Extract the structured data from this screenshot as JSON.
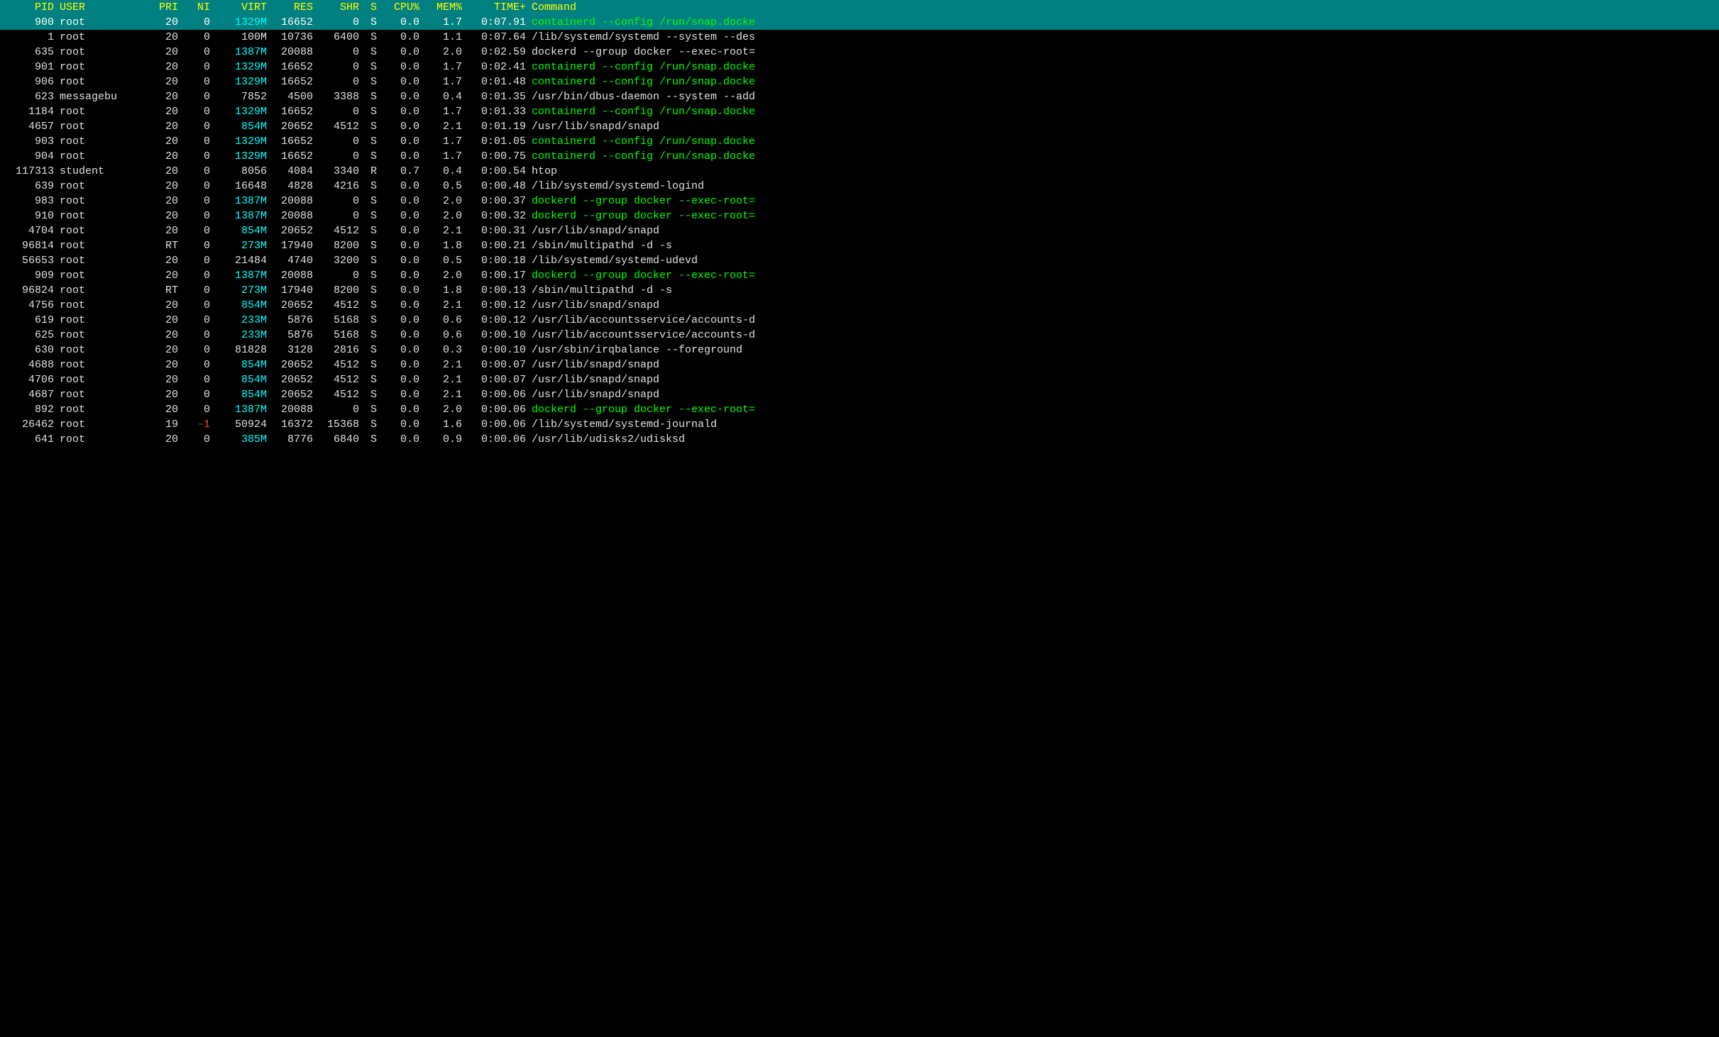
{
  "header": {
    "columns": [
      "PID",
      "USER",
      "PRI",
      "NI",
      "VIRT",
      "RES",
      "SHR",
      "S",
      "CPU%",
      "MEM%",
      "TIME+",
      "Command"
    ]
  },
  "processes": [
    {
      "pid": "900",
      "user": "root",
      "pri": "20",
      "ni": "0",
      "virt": "1329M",
      "res": "16652",
      "shr": "0",
      "s": "S",
      "cpu": "0.0",
      "mem": "1.7",
      "time": "0:07.91",
      "cmd": "containerd --config /run/snap.docke",
      "selected": true,
      "cmd_color": "green"
    },
    {
      "pid": "1",
      "user": "root",
      "pri": "20",
      "ni": "0",
      "virt": "100M",
      "res": "10736",
      "shr": "6400",
      "s": "S",
      "cpu": "0.0",
      "mem": "1.1",
      "time": "0:07.64",
      "cmd": "/lib/systemd/systemd --system --des",
      "selected": false,
      "cmd_color": "white"
    },
    {
      "pid": "635",
      "user": "root",
      "pri": "20",
      "ni": "0",
      "virt": "1387M",
      "res": "20088",
      "shr": "0",
      "s": "S",
      "cpu": "0.0",
      "mem": "2.0",
      "time": "0:02.59",
      "cmd": "dockerd --group docker --exec-root=",
      "selected": false,
      "cmd_color": "white"
    },
    {
      "pid": "901",
      "user": "root",
      "pri": "20",
      "ni": "0",
      "virt": "1329M",
      "res": "16652",
      "shr": "0",
      "s": "S",
      "cpu": "0.0",
      "mem": "1.7",
      "time": "0:02.41",
      "cmd": "containerd --config /run/snap.docke",
      "selected": false,
      "cmd_color": "green"
    },
    {
      "pid": "906",
      "user": "root",
      "pri": "20",
      "ni": "0",
      "virt": "1329M",
      "res": "16652",
      "shr": "0",
      "s": "S",
      "cpu": "0.0",
      "mem": "1.7",
      "time": "0:01.48",
      "cmd": "containerd --config /run/snap.docke",
      "selected": false,
      "cmd_color": "green"
    },
    {
      "pid": "623",
      "user": "messagebu",
      "pri": "20",
      "ni": "0",
      "virt": "7852",
      "res": "4500",
      "shr": "3388",
      "s": "S",
      "cpu": "0.0",
      "mem": "0.4",
      "time": "0:01.35",
      "cmd": "/usr/bin/dbus-daemon --system --add",
      "selected": false,
      "cmd_color": "white"
    },
    {
      "pid": "1184",
      "user": "root",
      "pri": "20",
      "ni": "0",
      "virt": "1329M",
      "res": "16652",
      "shr": "0",
      "s": "S",
      "cpu": "0.0",
      "mem": "1.7",
      "time": "0:01.33",
      "cmd": "containerd --config /run/snap.docke",
      "selected": false,
      "cmd_color": "green"
    },
    {
      "pid": "4657",
      "user": "root",
      "pri": "20",
      "ni": "0",
      "virt": "854M",
      "res": "20652",
      "shr": "4512",
      "s": "S",
      "cpu": "0.0",
      "mem": "2.1",
      "time": "0:01.19",
      "cmd": "/usr/lib/snapd/snapd",
      "selected": false,
      "cmd_color": "white"
    },
    {
      "pid": "903",
      "user": "root",
      "pri": "20",
      "ni": "0",
      "virt": "1329M",
      "res": "16652",
      "shr": "0",
      "s": "S",
      "cpu": "0.0",
      "mem": "1.7",
      "time": "0:01.05",
      "cmd": "containerd --config /run/snap.docke",
      "selected": false,
      "cmd_color": "green"
    },
    {
      "pid": "904",
      "user": "root",
      "pri": "20",
      "ni": "0",
      "virt": "1329M",
      "res": "16652",
      "shr": "0",
      "s": "S",
      "cpu": "0.0",
      "mem": "1.7",
      "time": "0:00.75",
      "cmd": "containerd --config /run/snap.docke",
      "selected": false,
      "cmd_color": "green"
    },
    {
      "pid": "117313",
      "user": "student",
      "pri": "20",
      "ni": "0",
      "virt": "8056",
      "res": "4084",
      "shr": "3340",
      "s": "R",
      "cpu": "0.7",
      "mem": "0.4",
      "time": "0:00.54",
      "cmd": "htop",
      "selected": false,
      "cmd_color": "white"
    },
    {
      "pid": "639",
      "user": "root",
      "pri": "20",
      "ni": "0",
      "virt": "16648",
      "res": "4828",
      "shr": "4216",
      "s": "S",
      "cpu": "0.0",
      "mem": "0.5",
      "time": "0:00.48",
      "cmd": "/lib/systemd/systemd-logind",
      "selected": false,
      "cmd_color": "white"
    },
    {
      "pid": "983",
      "user": "root",
      "pri": "20",
      "ni": "0",
      "virt": "1387M",
      "res": "20088",
      "shr": "0",
      "s": "S",
      "cpu": "0.0",
      "mem": "2.0",
      "time": "0:00.37",
      "cmd": "dockerd --group docker --exec-root=",
      "selected": false,
      "cmd_color": "green"
    },
    {
      "pid": "910",
      "user": "root",
      "pri": "20",
      "ni": "0",
      "virt": "1387M",
      "res": "20088",
      "shr": "0",
      "s": "S",
      "cpu": "0.0",
      "mem": "2.0",
      "time": "0:00.32",
      "cmd": "dockerd --group docker --exec-root=",
      "selected": false,
      "cmd_color": "green"
    },
    {
      "pid": "4704",
      "user": "root",
      "pri": "20",
      "ni": "0",
      "virt": "854M",
      "res": "20652",
      "shr": "4512",
      "s": "S",
      "cpu": "0.0",
      "mem": "2.1",
      "time": "0:00.31",
      "cmd": "/usr/lib/snapd/snapd",
      "selected": false,
      "cmd_color": "white"
    },
    {
      "pid": "96814",
      "user": "root",
      "pri": "RT",
      "ni": "0",
      "virt": "273M",
      "res": "17940",
      "shr": "8200",
      "s": "S",
      "cpu": "0.0",
      "mem": "1.8",
      "time": "0:00.21",
      "cmd": "/sbin/multipathd -d -s",
      "selected": false,
      "cmd_color": "white"
    },
    {
      "pid": "56653",
      "user": "root",
      "pri": "20",
      "ni": "0",
      "virt": "21484",
      "res": "4740",
      "shr": "3200",
      "s": "S",
      "cpu": "0.0",
      "mem": "0.5",
      "time": "0:00.18",
      "cmd": "/lib/systemd/systemd-udevd",
      "selected": false,
      "cmd_color": "white"
    },
    {
      "pid": "909",
      "user": "root",
      "pri": "20",
      "ni": "0",
      "virt": "1387M",
      "res": "20088",
      "shr": "0",
      "s": "S",
      "cpu": "0.0",
      "mem": "2.0",
      "time": "0:00.17",
      "cmd": "dockerd --group docker --exec-root=",
      "selected": false,
      "cmd_color": "green"
    },
    {
      "pid": "96824",
      "user": "root",
      "pri": "RT",
      "ni": "0",
      "virt": "273M",
      "res": "17940",
      "shr": "8200",
      "s": "S",
      "cpu": "0.0",
      "mem": "1.8",
      "time": "0:00.13",
      "cmd": "/sbin/multipathd -d -s",
      "selected": false,
      "cmd_color": "white"
    },
    {
      "pid": "4756",
      "user": "root",
      "pri": "20",
      "ni": "0",
      "virt": "854M",
      "res": "20652",
      "shr": "4512",
      "s": "S",
      "cpu": "0.0",
      "mem": "2.1",
      "time": "0:00.12",
      "cmd": "/usr/lib/snapd/snapd",
      "selected": false,
      "cmd_color": "white"
    },
    {
      "pid": "619",
      "user": "root",
      "pri": "20",
      "ni": "0",
      "virt": "233M",
      "res": "5876",
      "shr": "5168",
      "s": "S",
      "cpu": "0.0",
      "mem": "0.6",
      "time": "0:00.12",
      "cmd": "/usr/lib/accountsservice/accounts-d",
      "selected": false,
      "cmd_color": "white"
    },
    {
      "pid": "625",
      "user": "root",
      "pri": "20",
      "ni": "0",
      "virt": "233M",
      "res": "5876",
      "shr": "5168",
      "s": "S",
      "cpu": "0.0",
      "mem": "0.6",
      "time": "0:00.10",
      "cmd": "/usr/lib/accountsservice/accounts-d",
      "selected": false,
      "cmd_color": "white"
    },
    {
      "pid": "630",
      "user": "root",
      "pri": "20",
      "ni": "0",
      "virt": "81828",
      "res": "3128",
      "shr": "2816",
      "s": "S",
      "cpu": "0.0",
      "mem": "0.3",
      "time": "0:00.10",
      "cmd": "/usr/sbin/irqbalance --foreground",
      "selected": false,
      "cmd_color": "white"
    },
    {
      "pid": "4688",
      "user": "root",
      "pri": "20",
      "ni": "0",
      "virt": "854M",
      "res": "20652",
      "shr": "4512",
      "s": "S",
      "cpu": "0.0",
      "mem": "2.1",
      "time": "0:00.07",
      "cmd": "/usr/lib/snapd/snapd",
      "selected": false,
      "cmd_color": "white"
    },
    {
      "pid": "4706",
      "user": "root",
      "pri": "20",
      "ni": "0",
      "virt": "854M",
      "res": "20652",
      "shr": "4512",
      "s": "S",
      "cpu": "0.0",
      "mem": "2.1",
      "time": "0:00.07",
      "cmd": "/usr/lib/snapd/snapd",
      "selected": false,
      "cmd_color": "white"
    },
    {
      "pid": "4687",
      "user": "root",
      "pri": "20",
      "ni": "0",
      "virt": "854M",
      "res": "20652",
      "shr": "4512",
      "s": "S",
      "cpu": "0.0",
      "mem": "2.1",
      "time": "0:00.06",
      "cmd": "/usr/lib/snapd/snapd",
      "selected": false,
      "cmd_color": "white"
    },
    {
      "pid": "892",
      "user": "root",
      "pri": "20",
      "ni": "0",
      "virt": "1387M",
      "res": "20088",
      "shr": "0",
      "s": "S",
      "cpu": "0.0",
      "mem": "2.0",
      "time": "0:00.06",
      "cmd": "dockerd --group docker --exec-root=",
      "selected": false,
      "cmd_color": "green"
    },
    {
      "pid": "26462",
      "user": "root",
      "pri": "19",
      "ni": "-1",
      "virt": "50924",
      "res": "16372",
      "shr": "15368",
      "s": "S",
      "cpu": "0.0",
      "mem": "1.6",
      "time": "0:00.06",
      "cmd": "/lib/systemd/systemd-journald",
      "selected": false,
      "cmd_color": "white"
    },
    {
      "pid": "641",
      "user": "root",
      "pri": "20",
      "ni": "0",
      "virt": "385M",
      "res": "8776",
      "shr": "6840",
      "s": "S",
      "cpu": "0.0",
      "mem": "0.9",
      "time": "0:00.06",
      "cmd": "/usr/lib/udisks2/udisksd",
      "selected": false,
      "cmd_color": "white"
    }
  ]
}
